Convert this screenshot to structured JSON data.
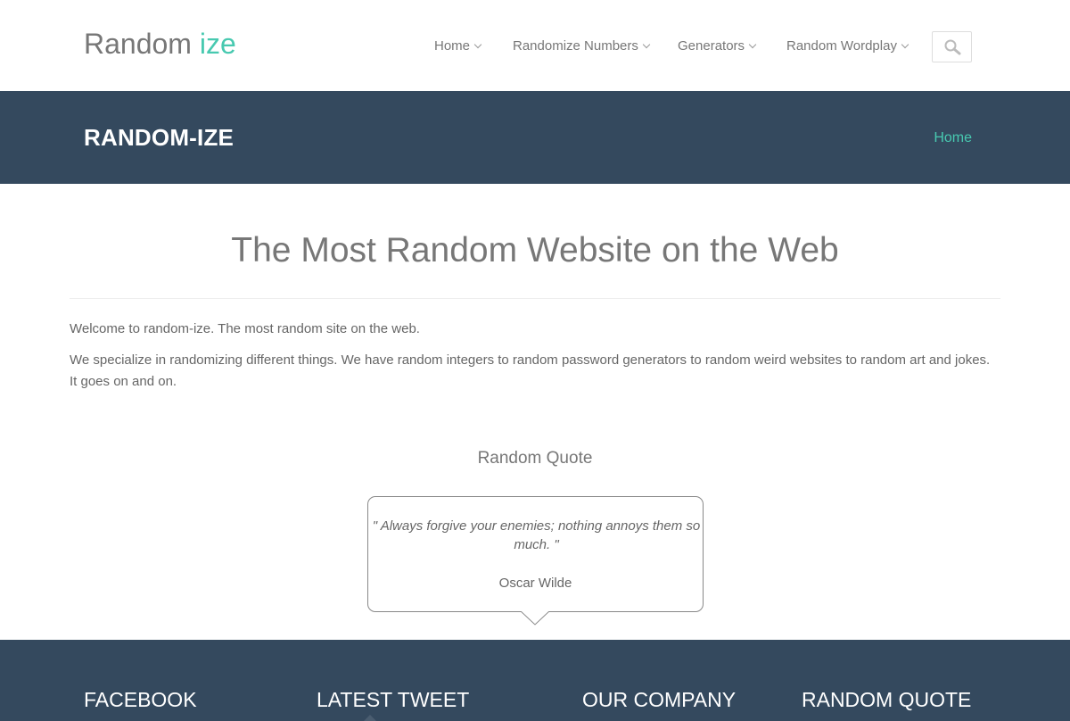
{
  "header": {
    "logo_main": "Random ",
    "logo_accent": "ize",
    "nav": [
      {
        "label": "Home"
      },
      {
        "label": "Randomize Numbers"
      },
      {
        "label": "Generators"
      },
      {
        "label": "Random Wordplay"
      }
    ],
    "search_icon": "search-icon"
  },
  "titlebar": {
    "title": "RANDOM-IZE",
    "breadcrumb": "Home"
  },
  "main": {
    "heading": "The Most Random Website on the Web",
    "paragraphs": [
      "Welcome to random-ize. The most random site on the web.",
      "We specialize in randomizing different things. We have random integers to random password generators to random weird websites to random art and jokes. It goes on and on."
    ],
    "quote_heading": "Random Quote",
    "quote_text": "\" Always forgive your enemies; nothing annoys them so much. \"",
    "quote_author": "Oscar Wilde"
  },
  "footer": {
    "headings": [
      "FACEBOOK",
      "LATEST TWEET",
      "OUR COMPANY",
      "RANDOM QUOTE"
    ]
  },
  "colors": {
    "accent": "#48c9b0",
    "dark_band": "#34495e",
    "text": "#666666"
  }
}
